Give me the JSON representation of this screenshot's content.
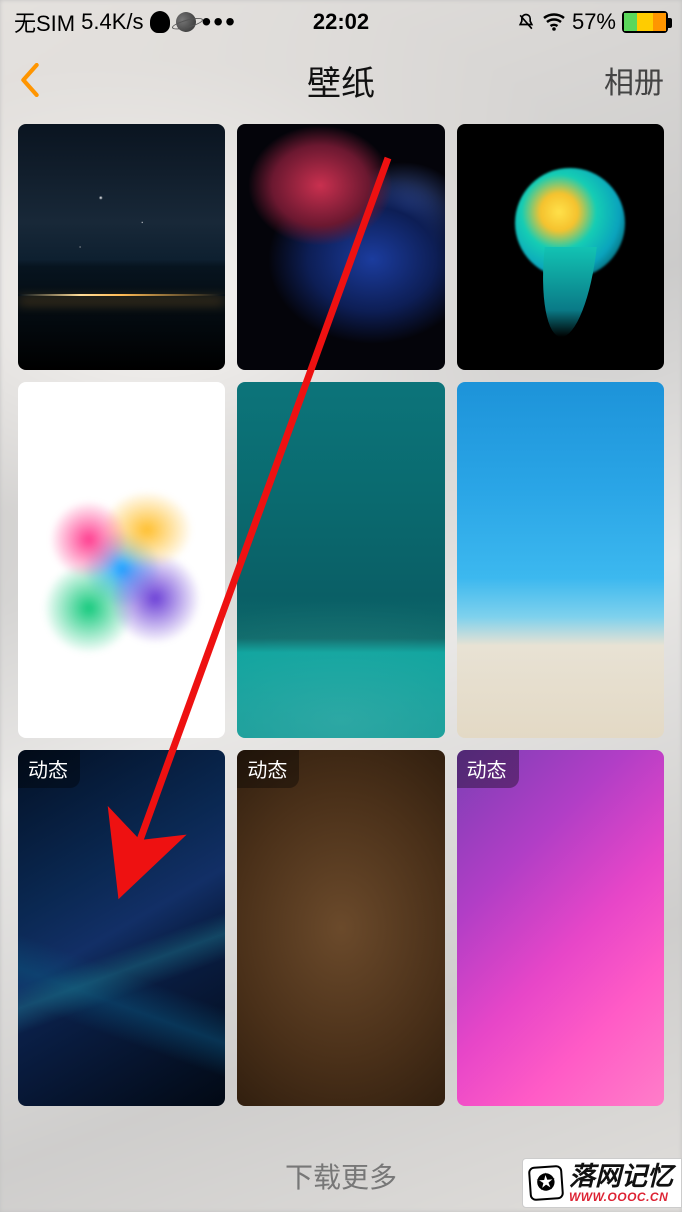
{
  "status": {
    "sim": "无SIM",
    "net_speed": "5.4K/s",
    "time": "22:02",
    "battery_pct": "57%"
  },
  "nav": {
    "title": "壁纸",
    "action": "相册"
  },
  "badges": {
    "dynamic": "动态"
  },
  "grid": {
    "items": [
      {
        "id": "night-sky"
      },
      {
        "id": "color-smoke"
      },
      {
        "id": "betta-fish"
      },
      {
        "id": "color-powder"
      },
      {
        "id": "teal-ocean"
      },
      {
        "id": "beach-aerial"
      },
      {
        "id": "blue-waves",
        "dynamic": true
      },
      {
        "id": "brown-abstract",
        "dynamic": true
      },
      {
        "id": "pink-gradient",
        "dynamic": true
      }
    ]
  },
  "footer": {
    "more": "下载更多"
  },
  "watermark": {
    "name_cn": "落网记忆",
    "url": "WWW.OOOC.CN"
  }
}
